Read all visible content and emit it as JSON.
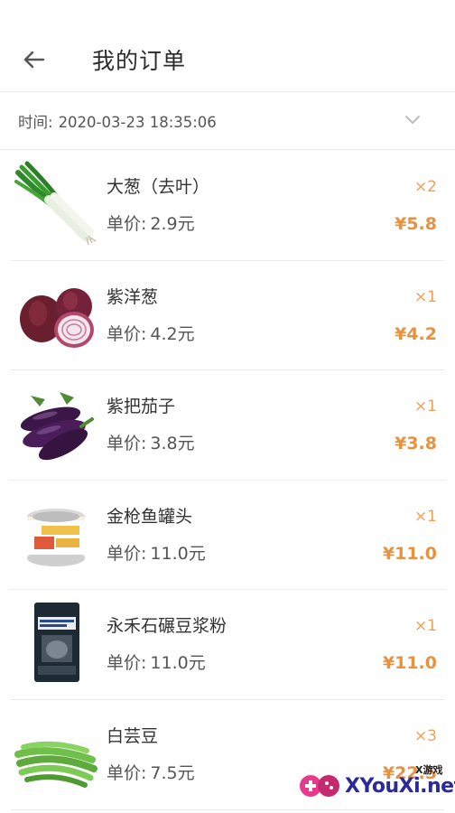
{
  "header": {
    "title": "我的订单"
  },
  "order": {
    "time_label": "时间:",
    "time_value": "2020-03-23 18:35:06"
  },
  "items": [
    {
      "name": "大葱（去叶）",
      "unit_label": "单价:",
      "unit_price": "2.9元",
      "qty": "×2",
      "total": "¥5.8",
      "icon": "scallion-icon"
    },
    {
      "name": "紫洋葱",
      "unit_label": "单价:",
      "unit_price": "4.2元",
      "qty": "×1",
      "total": "¥4.2",
      "icon": "red-onion-icon"
    },
    {
      "name": "紫把茄子",
      "unit_label": "单价:",
      "unit_price": "3.8元",
      "qty": "×1",
      "total": "¥3.8",
      "icon": "eggplant-icon"
    },
    {
      "name": "金枪鱼罐头",
      "unit_label": "单价:",
      "unit_price": "11.0元",
      "qty": "×1",
      "total": "¥11.0",
      "icon": "tuna-can-icon"
    },
    {
      "name": "永禾石碾豆浆粉",
      "unit_label": "单价:",
      "unit_price": "11.0元",
      "qty": "×1",
      "total": "¥11.0",
      "icon": "soy-powder-bag-icon"
    },
    {
      "name": "白芸豆",
      "unit_label": "单价:",
      "unit_price": "7.5元",
      "qty": "×3",
      "total": "¥22.5",
      "icon": "white-bean-icon"
    }
  ],
  "watermark": {
    "small": "X游戏",
    "main": "XYouXi.net"
  },
  "colors": {
    "accent": "#e8923f",
    "qty": "#f0a053",
    "divider": "#ececec"
  }
}
